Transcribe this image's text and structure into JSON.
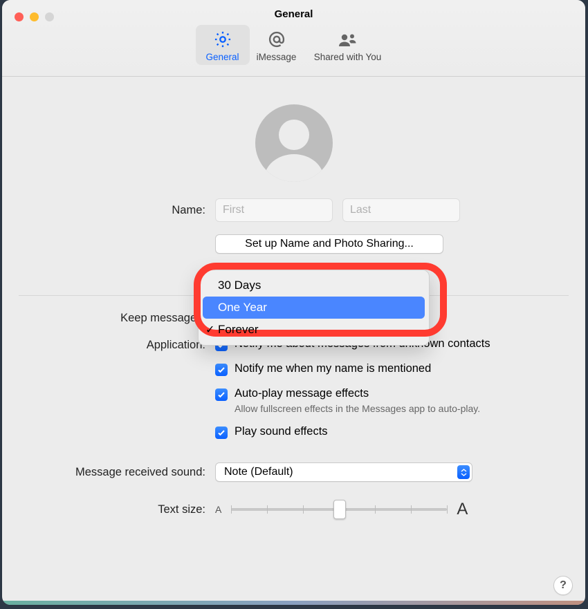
{
  "window": {
    "title": "General"
  },
  "tabs": {
    "general": "General",
    "imessage": "iMessage",
    "shared": "Shared with You"
  },
  "labels": {
    "name": "Name:",
    "keep_messages": "Keep messages:",
    "application": "Application:",
    "message_received_sound": "Message received sound:",
    "text_size": "Text size:"
  },
  "name_fields": {
    "first_placeholder": "First",
    "last_placeholder": "Last"
  },
  "buttons": {
    "setup_sharing": "Set up Name and Photo Sharing..."
  },
  "keep_messages_menu": {
    "options": [
      "30 Days",
      "One Year",
      "Forever"
    ],
    "highlighted": "One Year",
    "selected": "Forever"
  },
  "application_options": {
    "unknown_contacts": "Notify me about messages from unknown contacts",
    "name_mentioned": "Notify me when my name is mentioned",
    "autoplay_effects": "Auto-play message effects",
    "autoplay_subtext": "Allow fullscreen effects in the Messages app to auto-play.",
    "sound_effects": "Play sound effects"
  },
  "message_sound": {
    "value": "Note (Default)"
  },
  "text_size_labels": {
    "small": "A",
    "large": "A"
  },
  "help": "?"
}
